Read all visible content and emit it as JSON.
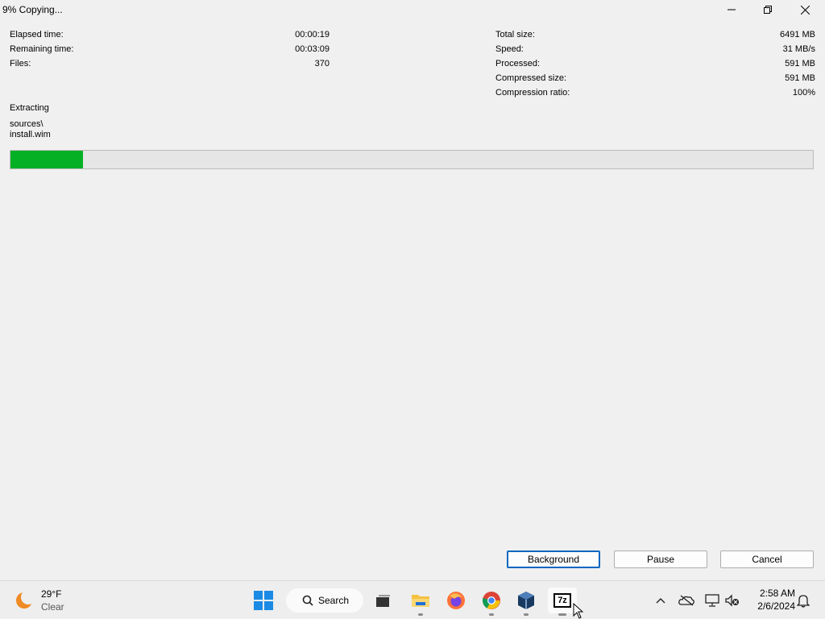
{
  "window": {
    "title": "9% Copying..."
  },
  "stats_left": [
    {
      "label": "Elapsed time:",
      "value": "00:00:19"
    },
    {
      "label": "Remaining time:",
      "value": "00:03:09"
    },
    {
      "label": "Files:",
      "value": "370"
    }
  ],
  "stats_right": [
    {
      "label": "Total size:",
      "value": "6491 MB"
    },
    {
      "label": "Speed:",
      "value": "31 MB/s"
    },
    {
      "label": "Processed:",
      "value": "591 MB"
    },
    {
      "label": "Compressed size:",
      "value": "591 MB"
    },
    {
      "label": "Compression ratio:",
      "value": "100%"
    }
  ],
  "operation": {
    "label": "Extracting",
    "path_line1": "sources\\",
    "path_line2": "install.wim"
  },
  "progress": {
    "fraction": 0.09,
    "color": "#06b025"
  },
  "buttons": {
    "background": "Background",
    "pause": "Pause",
    "cancel": "Cancel"
  },
  "taskbar": {
    "weather": {
      "temp": "29°F",
      "condition": "Clear"
    },
    "search_label": "Search",
    "apps": [
      "windows-start-icon",
      "task-view-icon",
      "file-explorer-icon",
      "firefox-icon",
      "chrome-icon",
      "virtualbox-icon",
      "7zip-icon"
    ],
    "app_7zip_label": "7z",
    "tray": [
      "chevron-up-icon",
      "onedrive-icon",
      "network-icon",
      "volume-muted-icon"
    ],
    "time": "2:58 AM",
    "date": "2/6/2024"
  }
}
